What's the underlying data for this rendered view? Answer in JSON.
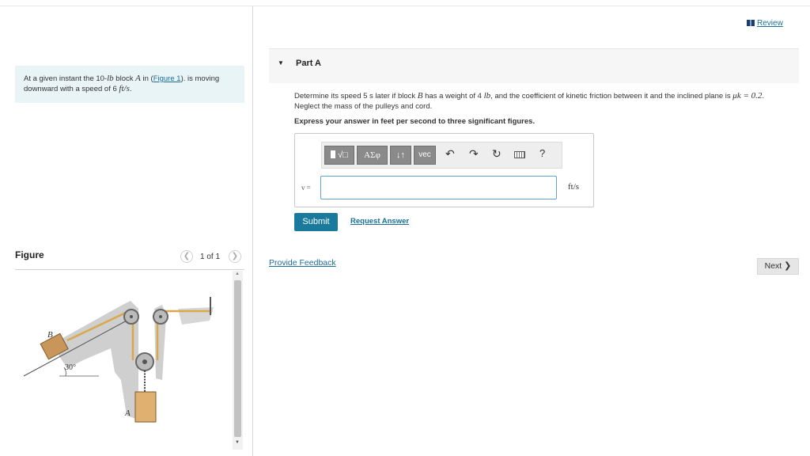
{
  "problem": {
    "text_before": "At a given instant the 10-",
    "weight_unit": "lb",
    "text_mid1": " block ",
    "block_name": "A",
    "text_mid2": " in (",
    "figure_link": "Figure 1",
    "text_mid3": "). is moving downward with a speed of 6 ",
    "speed_unit": "ft/s",
    "text_end": "."
  },
  "figure": {
    "title": "Figure",
    "count": "1 of 1",
    "labels": {
      "block_b": "B",
      "block_a": "A",
      "angle": "30°"
    }
  },
  "review": {
    "label": "Review",
    "icon": "book-icon"
  },
  "part": {
    "title": "Part A"
  },
  "question": {
    "t1": "Determine its speed 5 s later if block ",
    "block_b": "B",
    "t2": " has a weight of 4 ",
    "unit": "lb",
    "t3": ", and the coefficient of kinetic friction between it and the inclined plane is ",
    "mu": "μk = 0.2",
    "t4": ". Neglect the mass of the pulleys and cord."
  },
  "instruction": "Express your answer in feet per second to three significant figures.",
  "toolbar": {
    "templates": "√□",
    "greek": "ΑΣφ",
    "arrows": "↓↑",
    "vec": "vec",
    "undo": "↶",
    "redo": "↷",
    "reset": "↻",
    "help": "?"
  },
  "answer": {
    "label": "v =",
    "value": "",
    "unit": "ft/s"
  },
  "buttons": {
    "submit": "Submit",
    "request": "Request Answer",
    "feedback": "Provide Feedback",
    "next": "Next"
  },
  "colors": {
    "accent": "#197a9e",
    "link": "#1a6e98",
    "problem_bg": "#e9f4f7"
  }
}
